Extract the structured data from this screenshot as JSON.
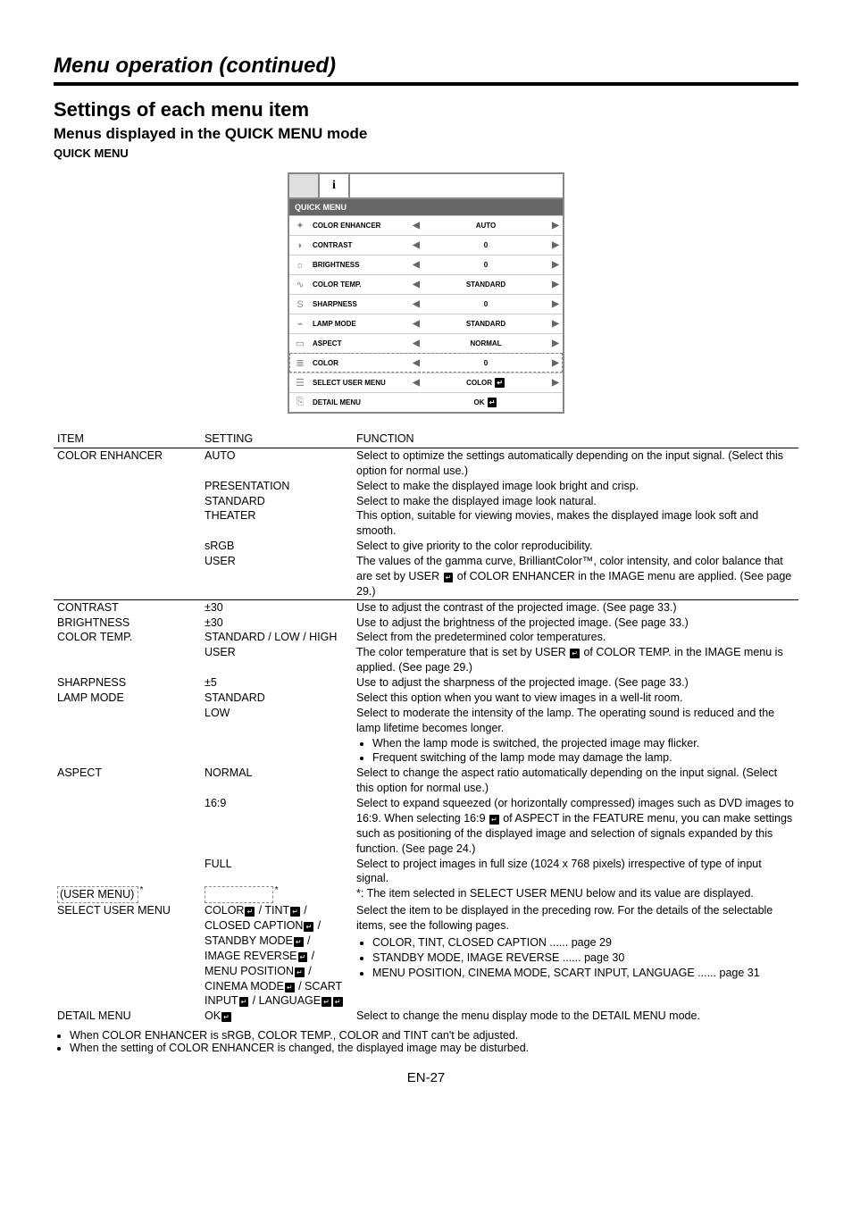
{
  "header": {
    "title": "Menu operation (continued)"
  },
  "headings": {
    "h2": "Settings of each menu item",
    "h3": "Menus displayed in the QUICK MENU mode",
    "h4": "QUICK MENU"
  },
  "osd": {
    "tab_info": "i",
    "header": "QUICK MENU",
    "rows": [
      {
        "icon": "✦",
        "label": "COLOR ENHANCER",
        "value": "AUTO",
        "arrows": true
      },
      {
        "icon": "◗",
        "label": "CONTRAST",
        "value": "0",
        "arrows": true
      },
      {
        "icon": "☼",
        "label": "BRIGHTNESS",
        "value": "0",
        "arrows": true
      },
      {
        "icon": "∿",
        "label": "COLOR TEMP.",
        "value": "STANDARD",
        "arrows": true
      },
      {
        "icon": "S",
        "label": "SHARPNESS",
        "value": "0",
        "arrows": true
      },
      {
        "icon": "⌁",
        "label": "LAMP MODE",
        "value": "STANDARD",
        "arrows": true
      },
      {
        "icon": "▭",
        "label": "ASPECT",
        "value": "NORMAL",
        "arrows": true
      },
      {
        "icon": "≣",
        "label": "COLOR",
        "value": "0",
        "arrows": true,
        "dashed": true
      },
      {
        "icon": "☰",
        "label": "SELECT USER MENU",
        "value": "COLOR ↵",
        "arrows": true
      },
      {
        "icon": "⎘",
        "label": "DETAIL MENU",
        "value": "OK ↵",
        "arrows": false
      }
    ]
  },
  "table": {
    "headers": {
      "item": "ITEM",
      "setting": "SETTING",
      "function": "FUNCTION"
    },
    "rows": [
      {
        "item": "COLOR ENHANCER",
        "subrows": [
          {
            "setting": "AUTO",
            "function": "Select to optimize the settings automatically depending on the input signal. (Select this option for normal use.)"
          },
          {
            "setting": "PRESENTATION",
            "function": "Select to make the displayed image look bright and crisp."
          },
          {
            "setting": "STANDARD",
            "function": "Select to make the displayed image look natural."
          },
          {
            "setting": "THEATER",
            "function": "This option, suitable for viewing movies, makes the displayed image look soft and smooth."
          },
          {
            "setting": "sRGB",
            "function": "Select to give priority to the color reproducibility."
          },
          {
            "setting": "USER",
            "function_pre": "The values of the gamma curve, BrilliantColor™, color intensity, and color balance that are set by USER ",
            "function_post": " of COLOR ENHANCER in the IMAGE menu are applied. (See page 29.)",
            "enter": true
          }
        ]
      },
      {
        "item": "CONTRAST",
        "subrows": [
          {
            "setting": "±30",
            "function": "Use to adjust the contrast of the projected image. (See page 33.)"
          }
        ]
      },
      {
        "item": "BRIGHTNESS",
        "subrows": [
          {
            "setting": "±30",
            "function": "Use to adjust the brightness of the projected image. (See page 33.)"
          }
        ]
      },
      {
        "item": "COLOR TEMP.",
        "subrows": [
          {
            "setting": "STANDARD / LOW / HIGH",
            "function": "Select from the predetermined color temperatures."
          },
          {
            "setting": "USER",
            "function_pre": "The color temperature that is set by USER ",
            "function_post": " of COLOR TEMP. in the IMAGE menu is applied. (See page 29.)",
            "enter": true
          }
        ]
      },
      {
        "item": "SHARPNESS",
        "subrows": [
          {
            "setting": "±5",
            "function": "Use to adjust the sharpness of the projected image. (See page 33.)"
          }
        ]
      },
      {
        "item": "LAMP MODE",
        "subrows": [
          {
            "setting": "STANDARD",
            "function": "Select this option when you want to view images in a well-lit room."
          },
          {
            "setting": "LOW",
            "function": "Select to moderate the intensity of the lamp. The operating sound is reduced and the lamp lifetime becomes longer."
          },
          {
            "bullets": [
              "When the lamp mode is switched, the projected image may flicker.",
              "Frequent switching of the lamp mode may damage the lamp."
            ]
          }
        ]
      },
      {
        "item": "ASPECT",
        "subrows": [
          {
            "setting": "NORMAL",
            "function": "Select to change the aspect ratio automatically depending on the input signal. (Select this option for normal use.)"
          },
          {
            "setting": "16:9",
            "function_pre": "Select to expand squeezed (or horizontally compressed) images such as DVD images to 16:9. When selecting 16:9 ",
            "function_post": " of ASPECT in the FEATURE menu, you can make settings such as positioning of the displayed image and selection of signals expanded by this function. (See page 24.)",
            "enter": true
          },
          {
            "setting": "FULL",
            "function": "Select to project images in full size (1024 x 768 pixels) irrespective of type of input signal."
          }
        ]
      },
      {
        "item_dashed": true,
        "item": "(USER MENU)",
        "subrows": [
          {
            "setting_dashed": true,
            "function": "*: The item selected in SELECT USER MENU below and its value are displayed."
          }
        ]
      },
      {
        "item": "SELECT USER MENU",
        "subrows": [
          {
            "setting_list": [
              "COLOR",
              " / TINT",
              " / CLOSED CAPTION",
              " / STANDBY MODE",
              " / IMAGE REVERSE",
              " / MENU POSITION",
              " / CINEMA MODE",
              " / SCART INPUT",
              " / LANGUAGE",
              ""
            ],
            "function_intro": "Select the item to be displayed in the preceding row. For the details of the selectable items, see the following pages.",
            "bullets": [
              "COLOR, TINT, CLOSED CAPTION ...... page 29",
              "STANDBY MODE, IMAGE REVERSE ...... page 30",
              "MENU POSITION, CINEMA MODE, SCART INPUT, LANGUAGE ...... page 31"
            ]
          }
        ]
      },
      {
        "item": "DETAIL MENU",
        "subrows": [
          {
            "setting": "OK",
            "setting_enter": true,
            "function": "Select to change the menu display mode to the DETAIL MENU mode."
          }
        ]
      }
    ]
  },
  "notes": [
    "When COLOR ENHANCER is sRGB, COLOR TEMP., COLOR and TINT can't be adjusted.",
    "When the setting of COLOR ENHANCER is changed, the displayed image may be disturbed."
  ],
  "pagenum": "EN-27"
}
